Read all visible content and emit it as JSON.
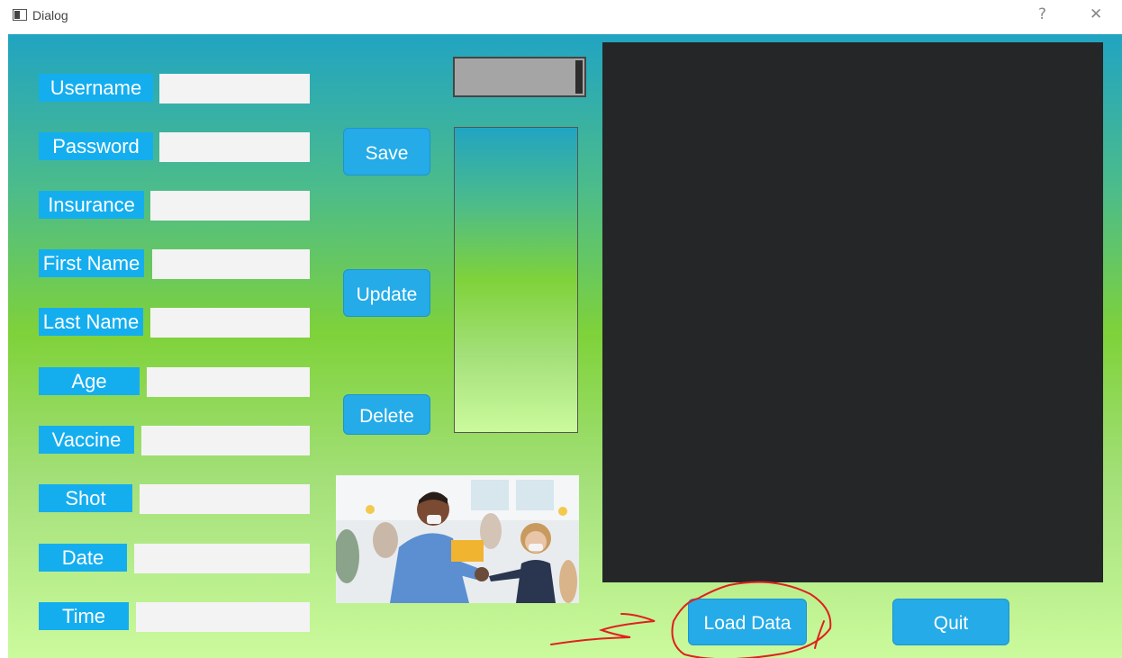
{
  "window": {
    "title": "Dialog",
    "help": "?",
    "close": "✕"
  },
  "fields": [
    {
      "label": "Username",
      "value": ""
    },
    {
      "label": "Password",
      "value": ""
    },
    {
      "label": "Insurance",
      "value": ""
    },
    {
      "label": "First Name",
      "value": ""
    },
    {
      "label": "Last Name",
      "value": ""
    },
    {
      "label": "Age",
      "value": ""
    },
    {
      "label": "Vaccine",
      "value": ""
    },
    {
      "label": "Shot",
      "value": ""
    },
    {
      "label": "Date",
      "value": ""
    },
    {
      "label": "Time",
      "value": ""
    }
  ],
  "actions": {
    "save": "Save",
    "update": "Update",
    "delete": "Delete",
    "load": "Load Data",
    "quit": "Quit"
  },
  "colors": {
    "label_bg": "#14aeef",
    "button_bg": "#24abe8",
    "panel_dark": "#252628",
    "annotation": "#e02020"
  }
}
